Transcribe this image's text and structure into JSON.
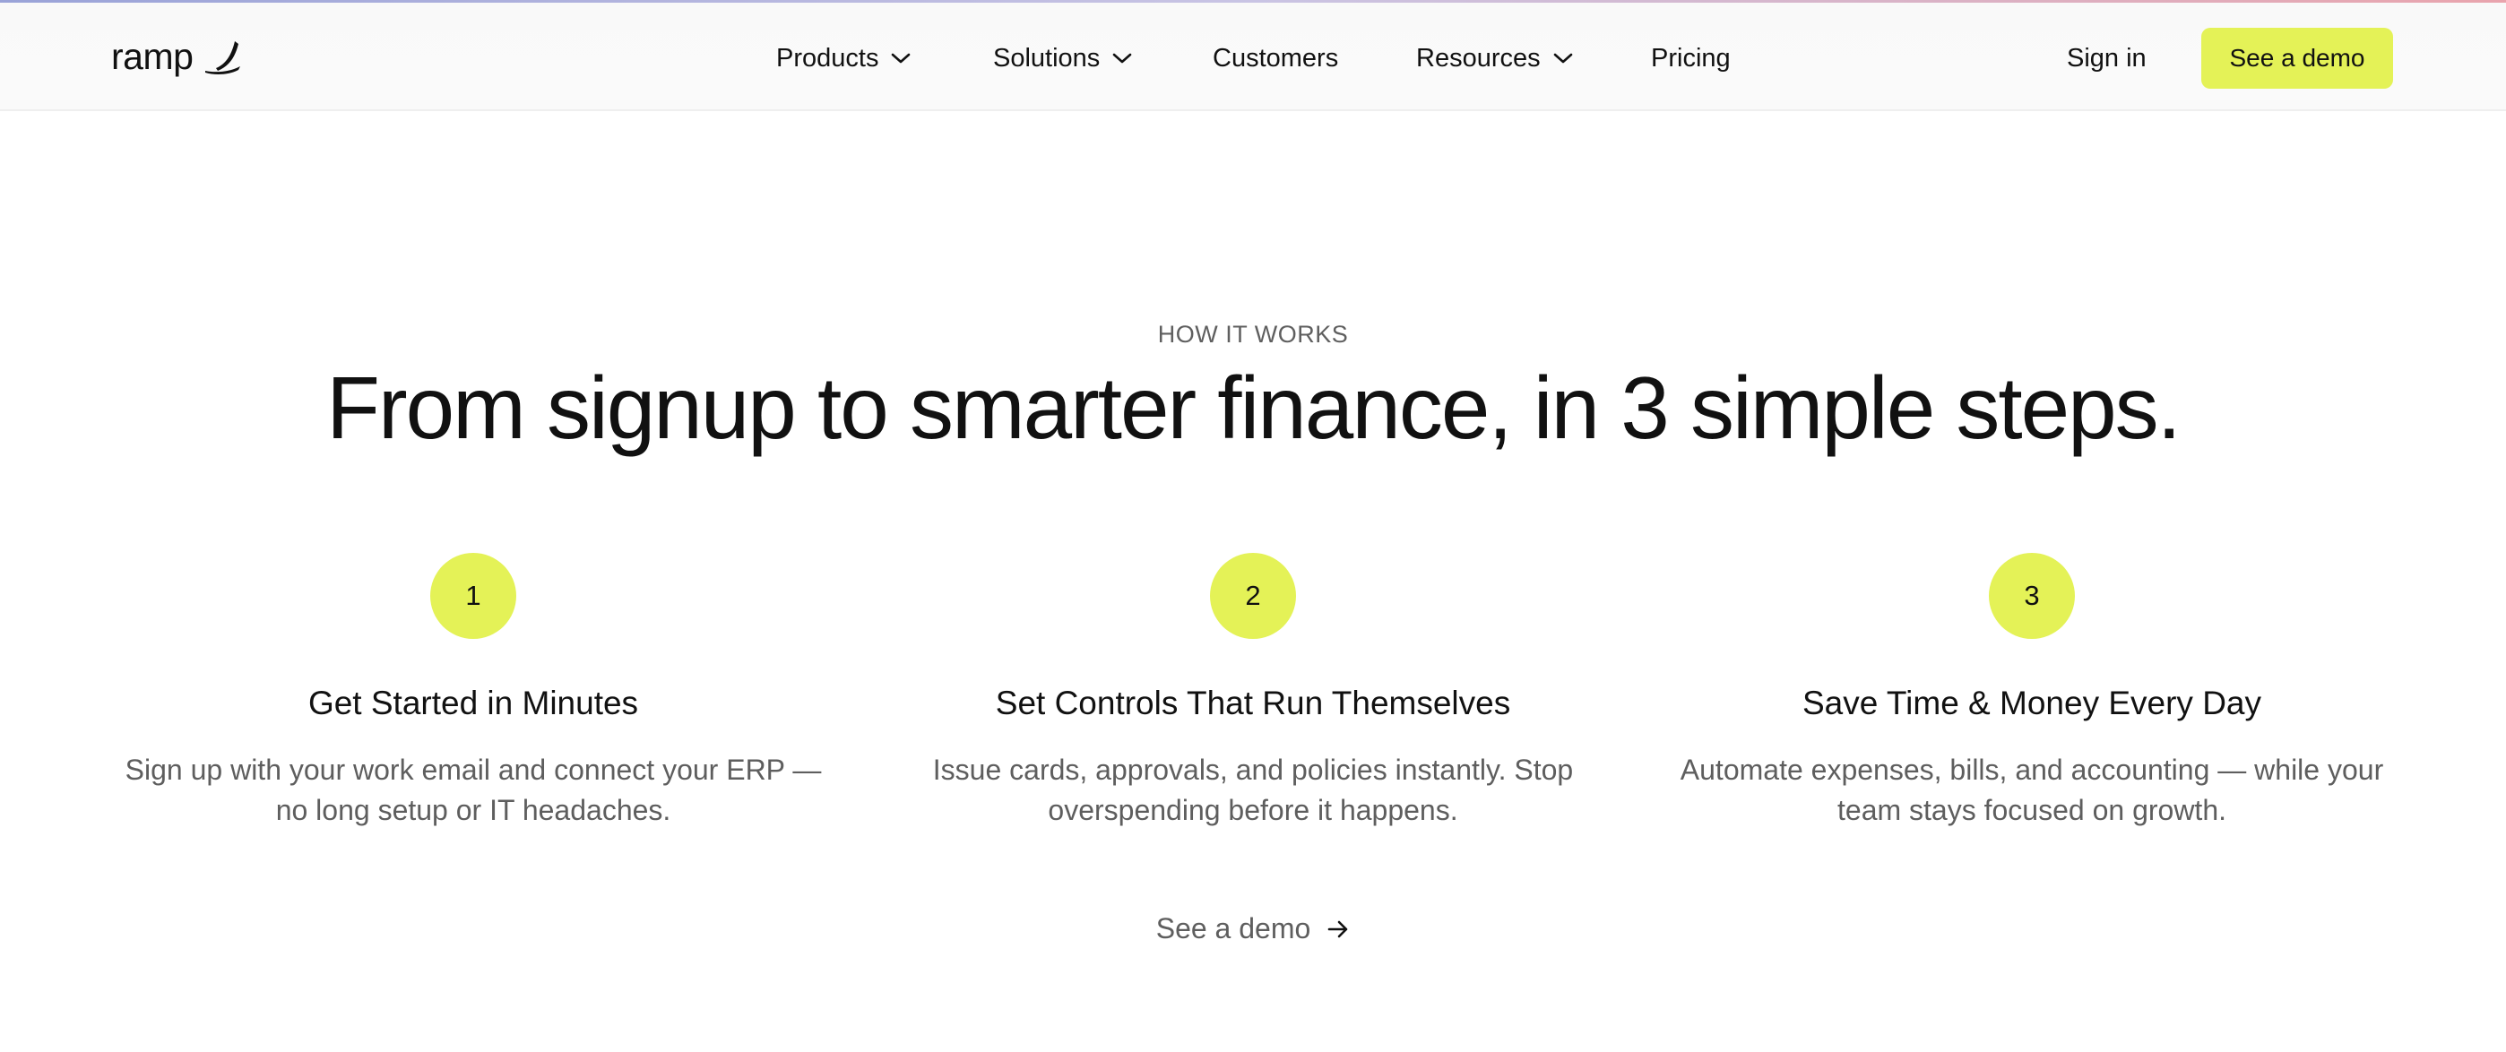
{
  "nav": {
    "logo_text": "ramp",
    "logo_icon": "ramp-bird-icon",
    "items": [
      {
        "label": "Products",
        "has_dropdown": true
      },
      {
        "label": "Solutions",
        "has_dropdown": true
      },
      {
        "label": "Customers",
        "has_dropdown": false
      },
      {
        "label": "Resources",
        "has_dropdown": true
      },
      {
        "label": "Pricing",
        "has_dropdown": false
      }
    ],
    "signin_label": "Sign in",
    "demo_label": "See a demo"
  },
  "hero": {
    "eyebrow": "HOW IT WORKS",
    "headline": "From signup to smarter finance, in 3 simple steps."
  },
  "steps": [
    {
      "number": "1",
      "title": "Get Started in Minutes",
      "desc_line1": "Sign up with your work email and connect your ERP —",
      "desc_line2": "no long setup or IT headaches."
    },
    {
      "number": "2",
      "title": "Set Controls That Run Themselves",
      "desc_line1": "Issue cards, approvals, and policies instantly. Stop",
      "desc_line2": "overspending before it happens."
    },
    {
      "number": "3",
      "title": "Save Time & Money Every Day",
      "desc_line1": "Automate expenses, bills, and accounting — while your",
      "desc_line2": "team stays focused on growth."
    }
  ],
  "cta": {
    "label": "See a demo",
    "icon": "arrow-right-icon"
  },
  "colors": {
    "accent": "#e4f257",
    "text": "#111111",
    "muted": "#5e5e5e"
  }
}
